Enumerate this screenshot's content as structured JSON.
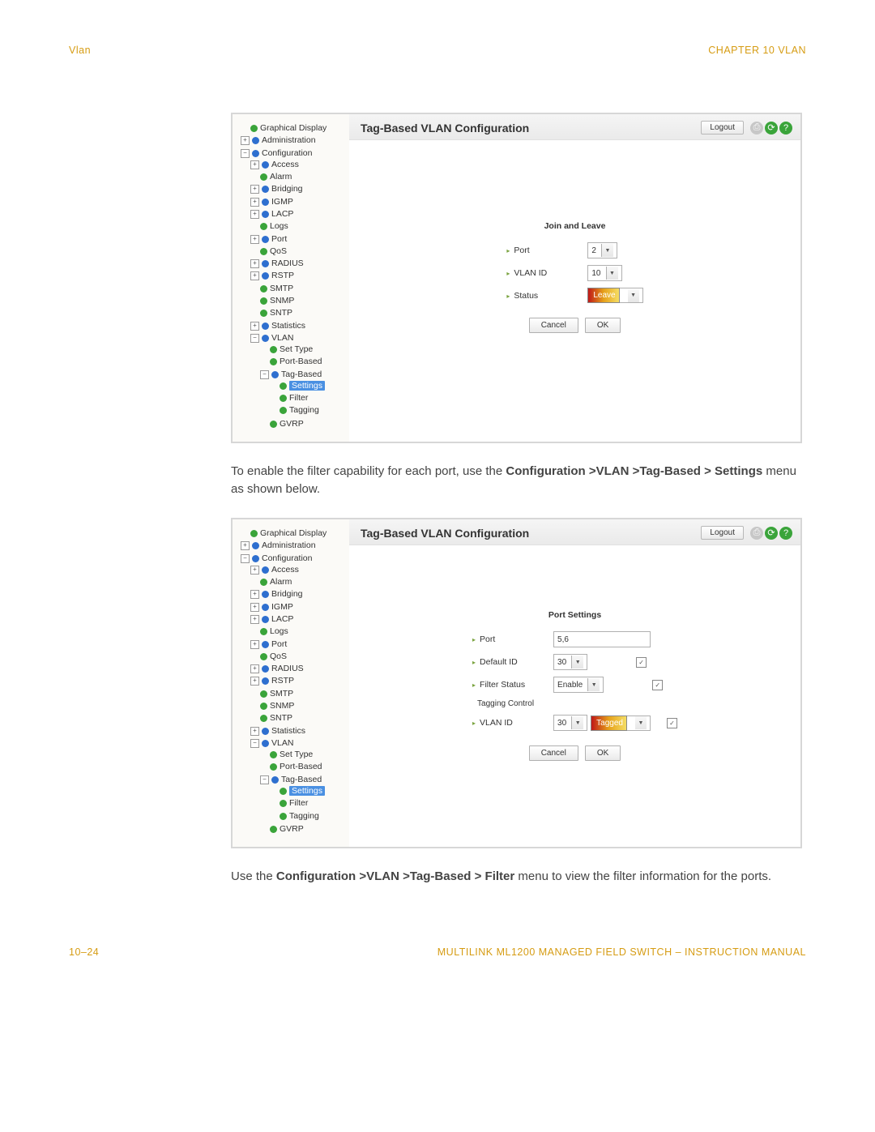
{
  "header": {
    "left": "Vlan",
    "right": "CHAPTER 10  VLAN"
  },
  "footer": {
    "left": "10–24",
    "right": "MULTILINK ML1200 MANAGED FIELD SWITCH – INSTRUCTION MANUAL"
  },
  "paragraph1": {
    "pre": "To enable the filter capability for each port, use the ",
    "bold": "Configuration >VLAN >Tag-Based > Settings",
    "post": " menu as shown below."
  },
  "paragraph2": {
    "pre": "Use the ",
    "bold": "Configuration >VLAN >Tag-Based > Filter",
    "post": " menu to view the filter information for the ports."
  },
  "panel_common": {
    "title": "Tag-Based VLAN Configuration",
    "logout": "Logout",
    "cancel": "Cancel",
    "ok": "OK",
    "tree": {
      "graphical": "Graphical Display",
      "admin": "Administration",
      "config": "Configuration",
      "access": "Access",
      "alarm": "Alarm",
      "bridging": "Bridging",
      "igmp": "IGMP",
      "lacp": "LACP",
      "logs": "Logs",
      "port": "Port",
      "qos": "QoS",
      "radius": "RADIUS",
      "rstp": "RSTP",
      "smtp": "SMTP",
      "snmp": "SNMP",
      "sntp": "SNTP",
      "stats": "Statistics",
      "vlan": "VLAN",
      "settype": "Set Type",
      "portbased": "Port-Based",
      "tagbased": "Tag-Based",
      "settings": "Settings",
      "filter": "Filter",
      "tagging": "Tagging",
      "gvrp": "GVRP"
    }
  },
  "panel_a": {
    "section_title": "Join and Leave",
    "port_label": "Port",
    "port_value": "2",
    "vlanid_label": "VLAN ID",
    "vlanid_value": "10",
    "status_label": "Status",
    "status_value": "Leave"
  },
  "panel_b": {
    "section_title": "Port Settings",
    "port_label": "Port",
    "port_value": "5,6",
    "defaultid_label": "Default ID",
    "defaultid_value": "30",
    "filterstatus_label": "Filter Status",
    "filterstatus_value": "Enable",
    "tagging_control_label": "Tagging Control",
    "vlanid_label": "VLAN ID",
    "vlanid_value": "30",
    "vlanid_tag": "Tagged"
  }
}
